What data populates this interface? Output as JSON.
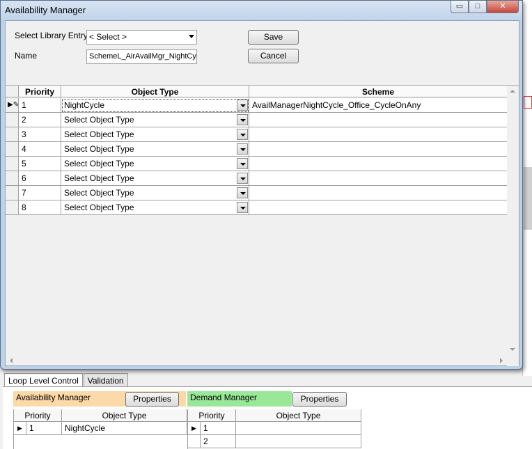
{
  "dialog": {
    "title": "Availability Manager",
    "window_buttons": {
      "minimize": "▭",
      "maximize": "□",
      "close": "✕"
    },
    "select_library_label": "Select Library Entry",
    "select_library_value": "< Select >",
    "name_label": "Name",
    "name_value": "SchemeL_AirAvailMgr_NightCyc",
    "save_label": "Save",
    "cancel_label": "Cancel",
    "grid": {
      "columns": [
        "Priority",
        "Object Type",
        "Scheme"
      ],
      "rows": [
        {
          "priority": "1",
          "type": "NightCycle",
          "scheme": "AvailManagerNightCycle_Office_CycleOnAny"
        },
        {
          "priority": "2",
          "type": "Select Object Type",
          "scheme": ""
        },
        {
          "priority": "3",
          "type": "Select Object Type",
          "scheme": ""
        },
        {
          "priority": "4",
          "type": "Select Object Type",
          "scheme": ""
        },
        {
          "priority": "5",
          "type": "Select Object Type",
          "scheme": ""
        },
        {
          "priority": "6",
          "type": "Select Object Type",
          "scheme": ""
        },
        {
          "priority": "7",
          "type": "Select Object Type",
          "scheme": ""
        },
        {
          "priority": "8",
          "type": "Select Object Type",
          "scheme": ""
        }
      ]
    }
  },
  "background": {
    "tabs": [
      "Loop Level Control",
      "Validation"
    ],
    "availability_panel": {
      "title": "Availability Manager",
      "properties_label": "Properties",
      "columns": [
        "Priority",
        "Object Type"
      ],
      "rows": [
        {
          "priority": "1",
          "type": "NightCycle"
        }
      ]
    },
    "demand_panel": {
      "title": "Demand Manager",
      "properties_label": "Properties",
      "columns": [
        "Priority",
        "Object Type"
      ],
      "rows": [
        {
          "priority": "1",
          "type": ""
        },
        {
          "priority": "2",
          "type": ""
        }
      ]
    }
  },
  "colors": {
    "availability_header": "#fcd9a8",
    "demand_header": "#98e898",
    "dialog_frame": "#bfd1e6"
  }
}
